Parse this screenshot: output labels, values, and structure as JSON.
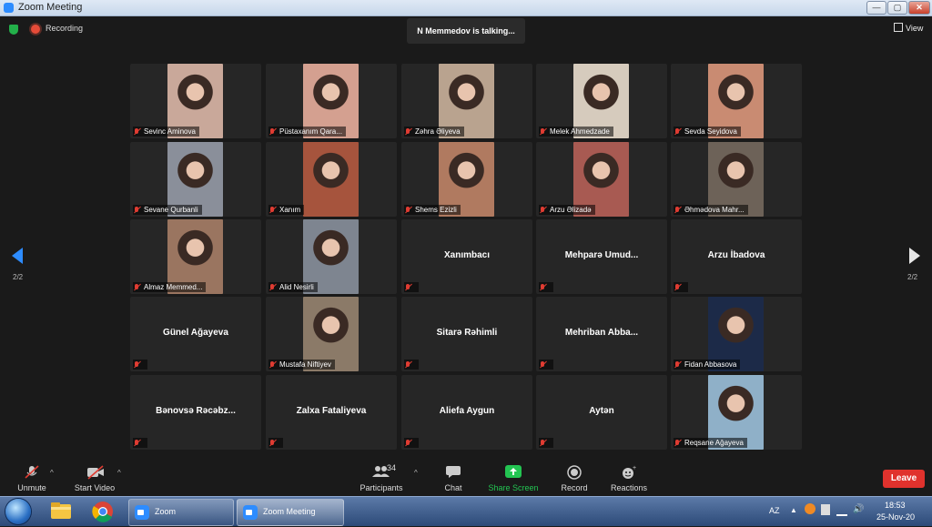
{
  "window": {
    "title": "Zoom Meeting"
  },
  "header": {
    "recording_label": "Recording",
    "talking": "N Memmedov is talking...",
    "view_label": "View"
  },
  "pagination": {
    "left": "2/2",
    "right": "2/2"
  },
  "participants": [
    {
      "name": "Sevinc Aminova",
      "video": true,
      "color": "#c9a89a"
    },
    {
      "name": "Püstaxanım Qara...",
      "video": true,
      "color": "#d4a090"
    },
    {
      "name": "Zəhra Əliyeva",
      "video": true,
      "color": "#b9a38f"
    },
    {
      "name": "Melek Ahmedzade",
      "video": true,
      "color": "#d6cbbd"
    },
    {
      "name": "Sevda Seyidova",
      "video": true,
      "color": "#c98b72"
    },
    {
      "name": "Sevane Qurbanli",
      "video": true,
      "color": "#8a8f9a"
    },
    {
      "name": "Xanım",
      "video": true,
      "color": "#a6543d"
    },
    {
      "name": "Shems Ezizli",
      "video": true,
      "color": "#b07a60"
    },
    {
      "name": "Arzu Əlizadə",
      "video": true,
      "color": "#a85a52"
    },
    {
      "name": "Əhmədova Mahr...",
      "video": true,
      "color": "#6d6258"
    },
    {
      "name": "Almaz Memmed...",
      "video": true,
      "color": "#9a7560"
    },
    {
      "name": "Alid Nesirli",
      "video": true,
      "color": "#7e8590"
    },
    {
      "name": "Xanımbacı",
      "video": false
    },
    {
      "name": "Mehparə Umud...",
      "video": false
    },
    {
      "name": "Arzu İbadova",
      "video": false
    },
    {
      "name": "Günel Ağayeva",
      "video": false
    },
    {
      "name": "Mustafa Niftiyev",
      "video": true,
      "color": "#8b7a68"
    },
    {
      "name": "Sitarə Rəhimli",
      "video": false
    },
    {
      "name": "Mehriban Abba...",
      "video": false
    },
    {
      "name": "Fidan Abbasova",
      "video": true,
      "color": "#1c2a48"
    },
    {
      "name": "Bənovsə Rəcəbz...",
      "video": false
    },
    {
      "name": "Zalxa Fataliyeva",
      "video": false
    },
    {
      "name": "Aliefa Aygun",
      "video": false
    },
    {
      "name": "Aytən",
      "video": false
    },
    {
      "name": "Reqsane Ağayeva",
      "video": true,
      "color": "#8fb0c8"
    }
  ],
  "toolbar": {
    "unmute": "Unmute",
    "start_video": "Start Video",
    "participants": "Participants",
    "participants_count": "34",
    "chat": "Chat",
    "share_screen": "Share Screen",
    "record": "Record",
    "reactions": "Reactions",
    "leave": "Leave"
  },
  "taskbar": {
    "zoom_label": "Zoom",
    "zoom_meeting_label": "Zoom Meeting",
    "lang": "AZ",
    "time": "18:53",
    "date": "25-Nov-20"
  },
  "colors": {
    "accent": "#2d8cff",
    "share_green": "#23c552",
    "leave_red": "#e0322d",
    "mic_red": "#e03c32"
  }
}
